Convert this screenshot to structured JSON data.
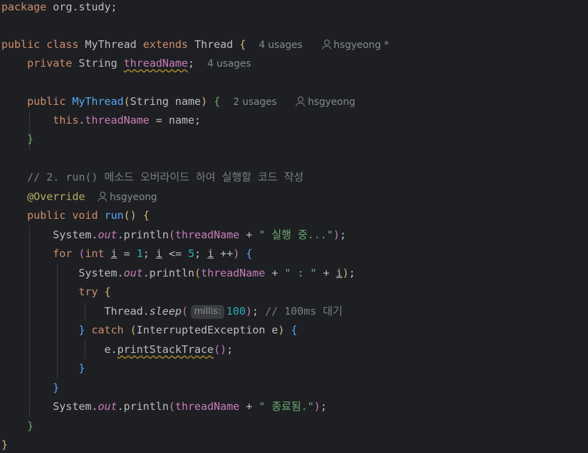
{
  "code": {
    "l1_keyword": "package",
    "l1_pkg": "org.study;",
    "l2_public": "public",
    "l2_class": "class",
    "l2_name": "MyThread",
    "l2_extends": "extends",
    "l2_super": "Thread",
    "l2_brace": "{",
    "l2_usages": "4 usages",
    "l2_author": "hsgyeong *",
    "l3_private": "private",
    "l3_type": "String",
    "l3_field": "threadName",
    "l3_semi": ";",
    "l3_usages": "4 usages",
    "l4_public": "public",
    "l4_name": "MyThread",
    "l4_params": "String name",
    "l4_brace": "{",
    "l4_usages": "2 usages",
    "l4_author": "hsgyeong",
    "l5_this": "this",
    "l5_field": "threadName",
    "l5_rest": " = name;",
    "l6_brace": "}",
    "l7_comment": "// 2. run() 메소드 오버라이드 하여 실행할 코드 작성",
    "l8_annotation": "@Override",
    "l8_author": "hsgyeong",
    "l9_public": "public",
    "l9_void": "void",
    "l9_name": "run",
    "l9_brace": "{",
    "l10_system": "System.",
    "l10_out": "out",
    "l10_println": ".println",
    "l10_field": "threadName",
    "l10_plus": " + ",
    "l10_str": "\" 실행 중...\"",
    "l10_end": ";",
    "l11_for": "for",
    "l11_int": "int",
    "l11_i1": "i",
    "l11_eq": " = ",
    "l11_one": "1",
    "l11_semi1": "; ",
    "l11_i2": "i",
    "l11_le": " <= ",
    "l11_five": "5",
    "l11_semi2": "; ",
    "l11_i3": "i",
    "l11_inc": " ++",
    "l11_brace": "{",
    "l12_system": "System.",
    "l12_out": "out",
    "l12_println": ".println",
    "l12_field": "threadName",
    "l12_plus1": " + ",
    "l12_str": "\" : \"",
    "l12_plus2": " + ",
    "l12_i": "i",
    "l12_end": ";",
    "l13_try": "try",
    "l13_brace": "{",
    "l14_thread": "Thread.",
    "l14_sleep": "sleep",
    "l14_hint": "millis:",
    "l14_num": "100",
    "l14_end": ";",
    "l14_comment": "// 100ms 대기",
    "l15_close": "}",
    "l15_catch": "catch",
    "l15_type": "InterruptedException e",
    "l15_brace": "{",
    "l16_e": "e.",
    "l16_call": "printStackTrace",
    "l16_end": ";",
    "l17_brace": "}",
    "l18_brace": "}",
    "l19_system": "System.",
    "l19_out": "out",
    "l19_println": ".println",
    "l19_field": "threadName",
    "l19_plus": " + ",
    "l19_str": "\" 종료됨.\"",
    "l19_end": ";",
    "l20_brace": "}",
    "l21_brace": "}"
  },
  "colors": {
    "background": "#1e1f22",
    "keyword": "#cf8e6d",
    "function": "#56a8f5",
    "field": "#c77dbb",
    "string": "#6aab73",
    "number": "#2aacb8",
    "comment": "#7a7e85",
    "annotation": "#b3ae60",
    "hint": "#868a91"
  },
  "icons": {
    "author": "person-icon"
  }
}
